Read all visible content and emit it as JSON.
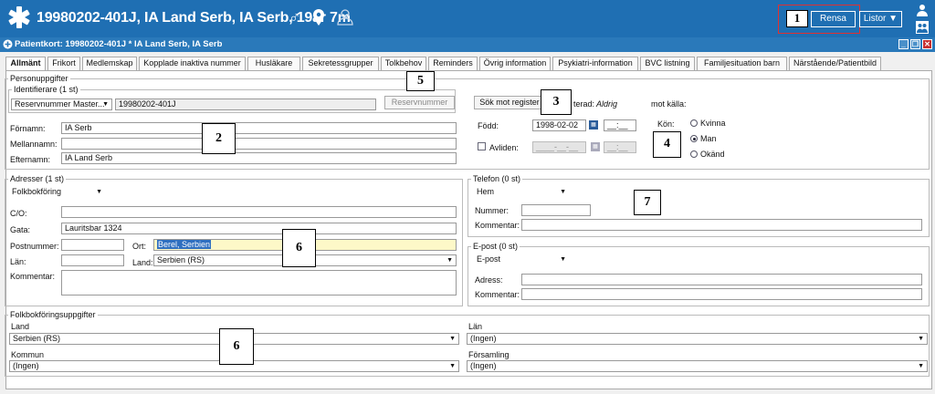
{
  "header": {
    "patient": "19980202-401J,  IA Land Serb, IA Serb,  19år 7m",
    "rensa": "Rensa",
    "listor": "Listor ▼"
  },
  "window": {
    "title": "Patientkort: 19980202-401J * IA Land Serb, IA Serb"
  },
  "tabs": [
    "Allmänt",
    "Frikort",
    "Medlemskap",
    "Kopplade inaktiva nummer",
    "Husläkare",
    "Sekretessgrupper",
    "Tolkbehov",
    "Reminders",
    "Övrig information",
    "Psykiatri-information",
    "BVC listning",
    "Familjesituation barn",
    "Närstående/Patientbild"
  ],
  "callouts": [
    "1",
    "2",
    "3",
    "4",
    "5",
    "6",
    "6",
    "7"
  ],
  "person": {
    "legend": "Personuppgifter",
    "id_legend": "Identifierare (1 st)",
    "id_type": "Reservnummer Master...",
    "id_value": "19980202-401J",
    "reserv_btn": "Reservnummer",
    "fornamn_lbl": "Förnamn:",
    "fornamn": "IA Serb",
    "mellannamn_lbl": "Mellannamn:",
    "efternamn_lbl": "Efternamn:",
    "efternamn": "IA Land Serb",
    "sok_btn": "Sök mot register",
    "verified_lbl": "terad:",
    "verified_val": "Aldrig",
    "motkalla_lbl": "mot källa:",
    "fodd_lbl": "Född:",
    "fodd": "1998-02-02",
    "time": "__:__",
    "avliden_lbl": "Avliden:",
    "avliden_date": "____-__-__",
    "avliden_time": "__:__",
    "kon_lbl": "Kön:",
    "kon": [
      "Kvinna",
      "Man",
      "Okänd"
    ]
  },
  "adresser": {
    "legend": "Adresser (1 st)",
    "type": "Folkbokföring",
    "co_lbl": "C/O:",
    "gata_lbl": "Gata:",
    "gata": "Lauritsbar 1324",
    "postnr_lbl": "Postnummer:",
    "ort_lbl": "Ort:",
    "ort": "Berel, Serbien",
    "lan_lbl": "Län:",
    "land_lbl": "Land:",
    "land": "Serbien (RS)",
    "komm_lbl": "Kommentar:"
  },
  "telefon": {
    "legend": "Telefon (0 st)",
    "type": "Hem",
    "nummer_lbl": "Nummer:",
    "komm_lbl": "Kommentar:"
  },
  "epost": {
    "legend": "E-post (0 st)",
    "type": "E-post",
    "adress_lbl": "Adress:",
    "komm_lbl": "Kommentar:"
  },
  "folk": {
    "legend": "Folkbokföringsuppgifter",
    "land_lbl": "Land",
    "land": "Serbien (RS)",
    "lan_lbl": "Län",
    "lan": "(Ingen)",
    "kommun_lbl": "Kommun",
    "kommun": "(Ingen)",
    "forsamling_lbl": "Församling",
    "forsamling": "(Ingen)"
  }
}
